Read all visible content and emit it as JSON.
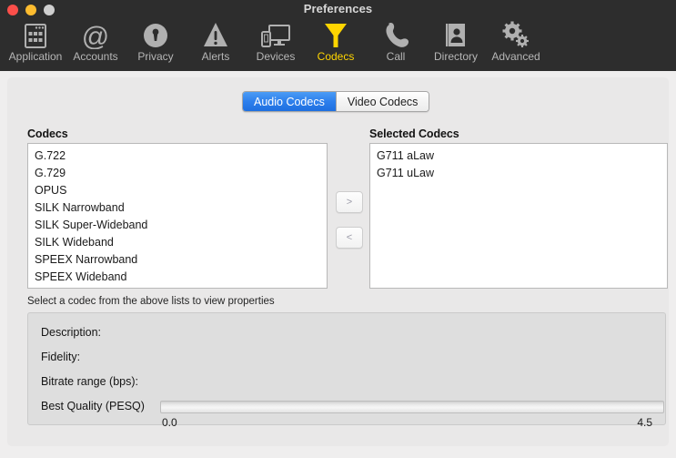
{
  "window": {
    "title": "Preferences",
    "traffic_lights": [
      "close",
      "minimize",
      "zoom"
    ],
    "colors": {
      "toolbar_bg": "#2d2d2d",
      "content_bg": "#efeeee",
      "panel_bg": "#e9e8e8",
      "accent_selected_tab": "#2d7fec",
      "active_toolbar_label": "#ffd500",
      "toolbar_label": "#b6b6b6",
      "props_bg": "#dedede"
    }
  },
  "toolbar": {
    "items": [
      {
        "label": "Application",
        "icon": "application-window-grid-icon",
        "active": false
      },
      {
        "label": "Accounts",
        "icon": "at-sign-icon",
        "active": false
      },
      {
        "label": "Privacy",
        "icon": "lock-circle-icon",
        "active": false
      },
      {
        "label": "Alerts",
        "icon": "warning-triangle-icon",
        "active": false
      },
      {
        "label": "Devices",
        "icon": "monitor-phone-icon",
        "active": false
      },
      {
        "label": "Codecs",
        "icon": "funnel-icon",
        "active": true
      },
      {
        "label": "Call",
        "icon": "phone-handset-icon",
        "active": false
      },
      {
        "label": "Directory",
        "icon": "address-book-person-icon",
        "active": false
      },
      {
        "label": "Advanced",
        "icon": "gears-icon",
        "active": false
      }
    ]
  },
  "tabs": {
    "items": [
      {
        "label": "Audio Codecs",
        "active": true
      },
      {
        "label": "Video Codecs",
        "active": false
      }
    ]
  },
  "codecs_panel": {
    "label": "Codecs",
    "items": [
      "G.722",
      "G.729",
      "OPUS",
      "SILK Narrowband",
      "SILK Super-Wideband",
      "SILK Wideband",
      "SPEEX Narrowband",
      "SPEEX Wideband"
    ]
  },
  "selected_panel": {
    "label": "Selected Codecs",
    "items": [
      "G711 aLaw",
      "G711 uLaw"
    ]
  },
  "transfer_buttons": {
    "add_label": ">",
    "remove_label": "<"
  },
  "properties": {
    "hint": "Select a codec from the above lists to view properties",
    "description_label": "Description:",
    "description_value": "",
    "fidelity_label": "Fidelity:",
    "fidelity_value": "",
    "bitrate_label": "Bitrate range (bps):",
    "bitrate_value": "",
    "quality_label": "Best Quality (PESQ)",
    "quality_min": "0.0",
    "quality_max": "4.5",
    "quality_value": 0
  }
}
